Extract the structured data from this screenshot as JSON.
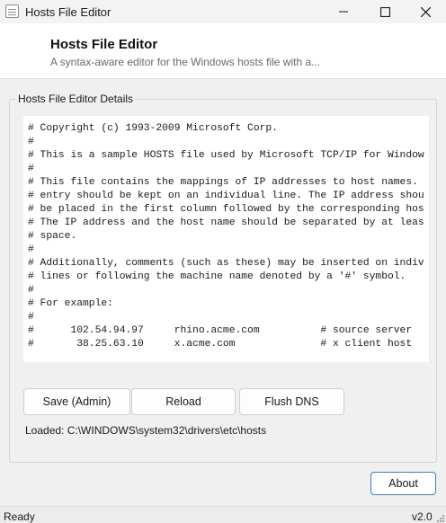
{
  "window": {
    "title": "Hosts File Editor"
  },
  "header": {
    "title": "Hosts File Editor",
    "subtitle": "A syntax-aware editor for the Windows hosts file with a..."
  },
  "group": {
    "legend": "Hosts File Editor Details"
  },
  "editor": {
    "lines": [
      "# Copyright (c) 1993-2009 Microsoft Corp.",
      "#",
      "# This is a sample HOSTS file used by Microsoft TCP/IP for Windows.",
      "#",
      "# This file contains the mappings of IP addresses to host names. Each",
      "# entry should be kept on an individual line. The IP address should",
      "# be placed in the first column followed by the corresponding host name.",
      "# The IP address and the host name should be separated by at least one",
      "# space.",
      "#",
      "# Additionally, comments (such as these) may be inserted on individual",
      "# lines or following the machine name denoted by a '#' symbol.",
      "#",
      "# For example:",
      "#",
      "#      102.54.94.97     rhino.acme.com          # source server",
      "#       38.25.63.10     x.acme.com              # x client host"
    ]
  },
  "buttons": {
    "save": "Save (Admin)",
    "reload": "Reload",
    "flush": "Flush DNS",
    "about": "About"
  },
  "loaded_path": "Loaded: C:\\WINDOWS\\system32\\drivers\\etc\\hosts",
  "status": {
    "text": "Ready",
    "version": "v2.0"
  },
  "icons": {
    "app": "notepad-icon",
    "minimize": "minimize-icon",
    "maximize": "maximize-icon",
    "close": "close-icon",
    "grip": "resize-grip-icon"
  }
}
